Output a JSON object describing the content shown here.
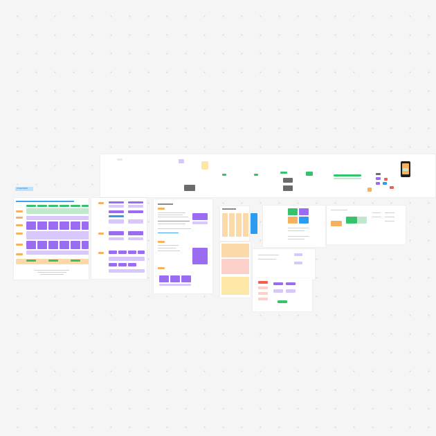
{
  "board": {
    "frame_label": "OVERVIEW",
    "sections": [
      {
        "title": "..."
      }
    ]
  }
}
